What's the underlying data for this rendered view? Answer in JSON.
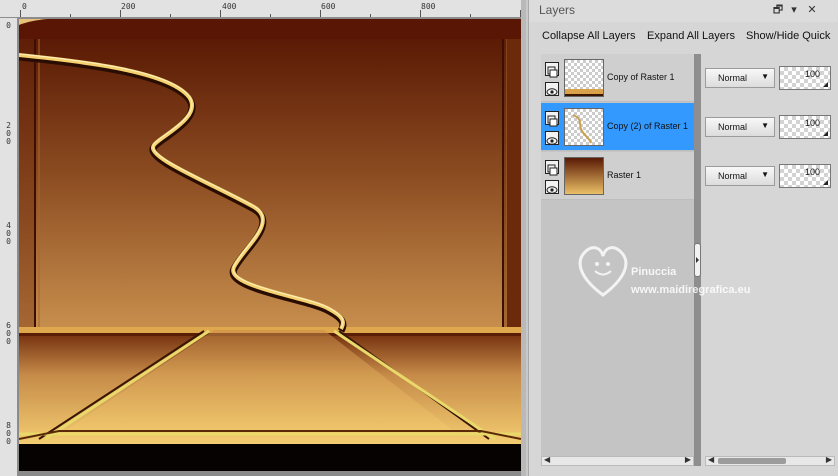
{
  "ruler": {
    "top_labels": [
      "0",
      "200",
      "400",
      "600",
      "800"
    ],
    "left_labels": [
      "0",
      "2 0 0",
      "4 0 0",
      "6 0 0",
      "8 0 0"
    ]
  },
  "layers_panel": {
    "title": "Layers",
    "window_buttons": {
      "restore": "🗗",
      "pin": "▾",
      "close": "✕"
    },
    "toolbar": {
      "collapse_all": "Collapse All Layers",
      "expand_all": "Expand All Layers",
      "show_hide_quick": "Show/Hide Quick"
    },
    "layers": [
      {
        "name": "Copy of Raster 1",
        "blend_mode": "Normal",
        "opacity": "100",
        "selected": false
      },
      {
        "name": "Copy (2) of Raster 1",
        "blend_mode": "Normal",
        "opacity": "100",
        "selected": true
      },
      {
        "name": "Raster 1",
        "blend_mode": "Normal",
        "opacity": "100",
        "selected": false
      }
    ],
    "icons": {
      "group": "layer-group-icon",
      "visibility": "eye-icon"
    }
  },
  "watermark": {
    "name": "Pinuccia",
    "url": "www.maidiregrafica.eu"
  },
  "colors": {
    "selected_row": "#3399ff",
    "canvas_dark": "#5a1a05",
    "canvas_mid": "#b47a3c",
    "canvas_light": "#f2c86c"
  }
}
